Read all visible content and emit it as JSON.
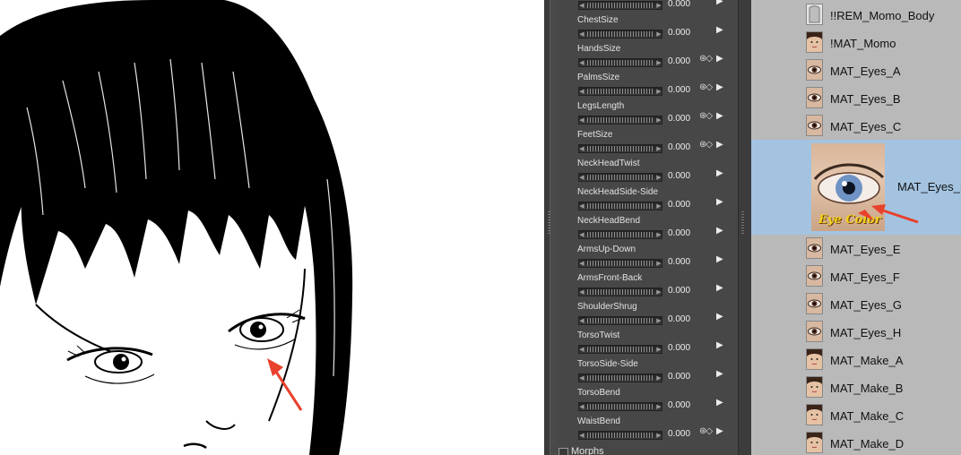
{
  "parameters": {
    "dials": [
      {
        "label": "",
        "value": "0.000",
        "has_icons": false
      },
      {
        "label": "ChestSize",
        "value": "0.000",
        "has_icons": false
      },
      {
        "label": "HandsSize",
        "value": "0.000",
        "has_icons": true
      },
      {
        "label": "PalmsSize",
        "value": "0.000",
        "has_icons": true
      },
      {
        "label": "LegsLength",
        "value": "0.000",
        "has_icons": true
      },
      {
        "label": "FeetSize",
        "value": "0.000",
        "has_icons": true
      },
      {
        "label": "NeckHeadTwist",
        "value": "0.000",
        "has_icons": false
      },
      {
        "label": "NeckHeadSide-Side",
        "value": "0.000",
        "has_icons": false
      },
      {
        "label": "NeckHeadBend",
        "value": "0.000",
        "has_icons": false
      },
      {
        "label": "ArmsUp-Down",
        "value": "0.000",
        "has_icons": false
      },
      {
        "label": "ArmsFront-Back",
        "value": "0.000",
        "has_icons": false
      },
      {
        "label": "ShoulderShrug",
        "value": "0.000",
        "has_icons": false
      },
      {
        "label": "TorsoTwist",
        "value": "0.000",
        "has_icons": false
      },
      {
        "label": "TorsoSide-Side",
        "value": "0.000",
        "has_icons": false
      },
      {
        "label": "TorsoBend",
        "value": "0.000",
        "has_icons": false
      },
      {
        "label": "WaistBend",
        "value": "0.000",
        "has_icons": true
      }
    ],
    "morphs_label": "Morphs",
    "icon_glyphs": "⊛◇",
    "arrow_glyph": "▶",
    "left_glyph": "◀"
  },
  "materials": {
    "items": [
      {
        "label": "!!REM_Momo_Body",
        "thumb": "rem-icon"
      },
      {
        "label": "!MAT_Momo",
        "thumb": "face-icon"
      },
      {
        "label": "MAT_Eyes_A",
        "thumb": "eye-icon"
      },
      {
        "label": "MAT_Eyes_B",
        "thumb": "eye-icon"
      },
      {
        "label": "MAT_Eyes_C",
        "thumb": "eye-icon"
      },
      {
        "label": "MAT_Eyes_D",
        "thumb": "eye-icon",
        "selected": true
      },
      {
        "label": "MAT_Eyes_E",
        "thumb": "eye-icon"
      },
      {
        "label": "MAT_Eyes_F",
        "thumb": "eye-icon"
      },
      {
        "label": "MAT_Eyes_G",
        "thumb": "eye-icon"
      },
      {
        "label": "MAT_Eyes_H",
        "thumb": "eye-icon"
      },
      {
        "label": "MAT_Make_A",
        "thumb": "face-icon"
      },
      {
        "label": "MAT_Make_B",
        "thumb": "face-icon"
      },
      {
        "label": "MAT_Make_C",
        "thumb": "face-icon"
      },
      {
        "label": "MAT_Make_D",
        "thumb": "face-icon"
      }
    ],
    "selected_thumb_caption": "Eye Color"
  },
  "colors": {
    "panel_bg": "#4a4a4a",
    "list_bg": "#b9b9b9",
    "selection": "#a3c3e0",
    "annotation_arrow": "#e8412c"
  }
}
